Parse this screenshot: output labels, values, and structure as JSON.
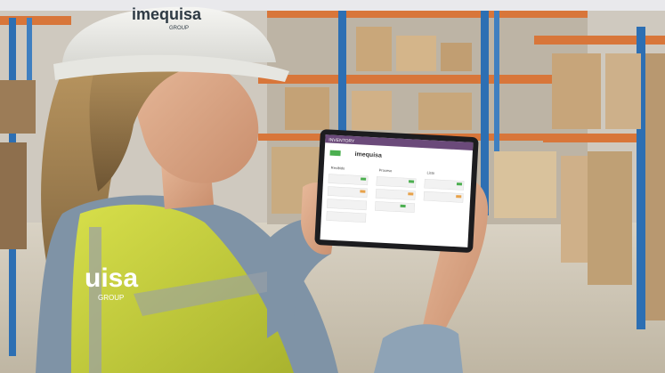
{
  "helmet": {
    "brand": "imequisa",
    "sub": "GROUP"
  },
  "vest": {
    "brand": "uisa",
    "sub": "GROUP"
  },
  "tablet": {
    "app_title": "INVENTORY",
    "header_logo": "imequisa",
    "columns": [
      "Recibido",
      "Proceso",
      "Listo"
    ]
  },
  "colors": {
    "shelf_orange": "#d8763a",
    "rack_blue": "#2d6fb3",
    "vest_yellow": "#c8d23c",
    "app_bar": "#6b4a7a",
    "tag_green": "#4caf50",
    "tag_orange": "#e8a24a"
  }
}
